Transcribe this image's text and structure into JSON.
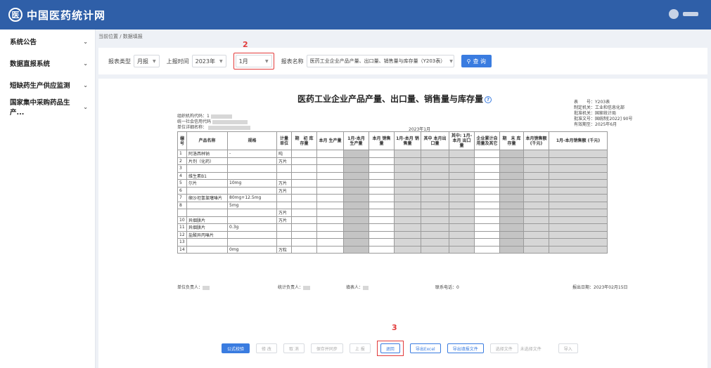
{
  "header": {
    "logo_glyph": "医",
    "title": "中国医药统计网"
  },
  "sidebar": {
    "items": [
      {
        "label": "系统公告"
      },
      {
        "label": "数据直报系统"
      },
      {
        "label": "短缺药生产供应监测"
      },
      {
        "label": "国家集中采购药品生产..."
      }
    ]
  },
  "breadcrumb": "当前位置 / 数据填报",
  "toolbar": {
    "report_type_label": "报表类型",
    "report_type_value": "月报",
    "report_time_label": "上报时间",
    "year_value": "2023年",
    "month_value": "1月",
    "report_name_label": "报表名称",
    "report_name_value": "医药工业企业产品产量、出口量、销售量与库存量（Y203表）",
    "search_label": "查 询",
    "search_icon": "search-icon"
  },
  "annotations": {
    "step2": "2",
    "step3": "3"
  },
  "report": {
    "title": "医药工业企业产品产量、出口量、销售量与库存量",
    "meta_left": [
      "组织机构代码：1",
      "统一社会信用代码",
      "单位详细名称："
    ],
    "meta_right": [
      "表　　号：Y203表",
      "制定机关：工业和信息化部",
      "批准机关：国家统计局",
      "批准文号：国统制[2022] 90号",
      "有效期至：2025年6月"
    ],
    "period": "2023年1月",
    "columns": [
      "编号",
      "产品名称",
      "规格",
      "计量单位",
      "期　初 库存量",
      "本月 生产量",
      "1月-本月 生产量",
      "本月 销售量",
      "1月-本月 销售量",
      "其中 本月出口量",
      "其中: 1月-本月 出口量",
      "企业累计自 用量及其它",
      "期　末 库存量",
      "本月销售额 (千元)",
      "1月-本月销售额 (千元)"
    ],
    "rows": [
      {
        "no": "1",
        "name": "阿洛西林钠",
        "spec": "-",
        "unit": "吨"
      },
      {
        "no": "2",
        "name": "片剂（化药）",
        "spec": "",
        "unit": "万片"
      },
      {
        "no": "3",
        "name": "",
        "spec": "",
        "unit": ""
      },
      {
        "no": "4",
        "name": "维生素B1",
        "spec": "",
        "unit": ""
      },
      {
        "no": "5",
        "name": "尔片",
        "spec": "10mg",
        "unit": "万片"
      },
      {
        "no": "6",
        "name": "",
        "spec": "",
        "unit": "万片"
      },
      {
        "no": "7",
        "name": "缬沙坦氢氯噻嗪片",
        "spec": "80mg+12.5mg",
        "unit": ""
      },
      {
        "no": "8",
        "name": "",
        "spec": "5mg",
        "unit": ""
      },
      {
        "no": "",
        "name": "",
        "spec": "",
        "unit": "万片"
      },
      {
        "no": "10",
        "name": "异烟肼片",
        "spec": "",
        "unit": "万片"
      },
      {
        "no": "11",
        "name": "异烟肼片",
        "spec": "0.3g",
        "unit": ""
      },
      {
        "no": "12",
        "name": "盐酸异丙嗪片",
        "spec": "",
        "unit": ""
      },
      {
        "no": "13",
        "name": "",
        "spec": "",
        "unit": ""
      },
      {
        "no": "14",
        "name": "",
        "spec": "0mg",
        "unit": "万粒"
      }
    ],
    "footer": {
      "unit_head": "单位负责人：",
      "stat_head": "统计负责人：",
      "filler": "填表人：",
      "phone": "联系电话：0",
      "report_date": "报出日期：2023年02月15日"
    }
  },
  "actions": {
    "formula_check": "公式校验",
    "modify": "修 改",
    "cancel": "取 消",
    "save_sync": "保存并同步",
    "report": "上 报",
    "return": "退回",
    "export_excel": "导出Excel",
    "export_file": "导出填报文件",
    "select_file": "选择文件",
    "no_file": "未选择文件",
    "import": "导入"
  }
}
